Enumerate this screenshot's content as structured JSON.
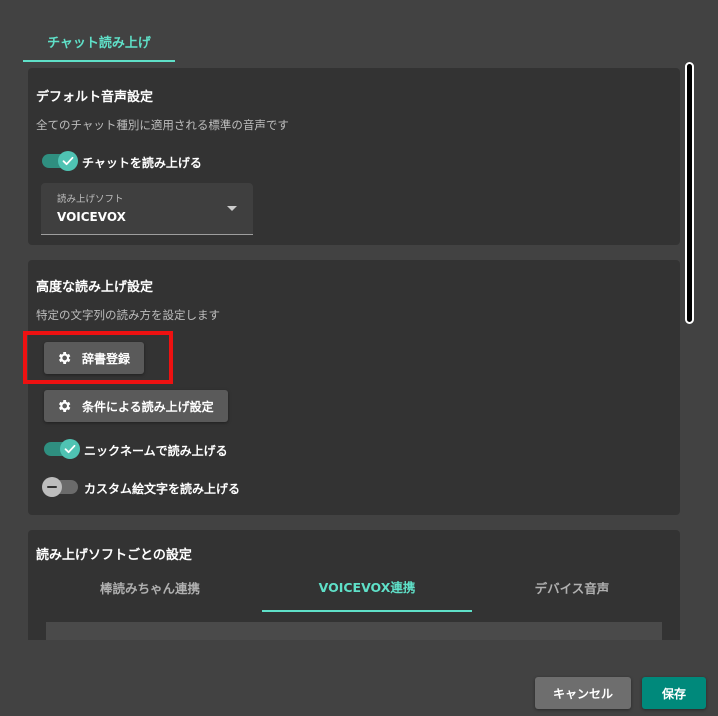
{
  "top_tabs": [
    {
      "label": "チャット読み上げ",
      "active": true
    }
  ],
  "default_voice": {
    "title": "デフォルト音声設定",
    "description": "全てのチャット種別に適用される標準の音声です",
    "toggle_read_chat": {
      "label": "チャットを読み上げる",
      "checked": true
    },
    "software_select": {
      "label": "読み上げソフト",
      "value": "VOICEVOX"
    }
  },
  "advanced": {
    "title": "高度な読み上げ設定",
    "description": "特定の文字列の読み方を設定します",
    "dictionary_button": "辞書登録",
    "condition_button": "条件による読み上げ設定",
    "toggle_nickname": {
      "label": "ニックネームで読み上げる",
      "checked": true
    },
    "toggle_custom_emoji": {
      "label": "カスタム絵文字を読み上げる",
      "checked": false
    }
  },
  "per_software": {
    "title": "読み上げソフトごとの設定",
    "tabs": [
      {
        "label": "棒読みちゃん連携",
        "active": false
      },
      {
        "label": "VOICEVOX連携",
        "active": true
      },
      {
        "label": "デバイス音声",
        "active": false
      }
    ]
  },
  "footer": {
    "cancel": "キャンセル",
    "save": "保存"
  },
  "colors": {
    "accent": "#5fe0c8",
    "save_button": "#00897b",
    "cancel_button": "#6e6e6e",
    "highlight": "#ee1111",
    "background": "#424242",
    "card": "#333333"
  },
  "icons": [
    "gear-icon",
    "check-icon",
    "minus-icon",
    "chevron-down-icon"
  ]
}
